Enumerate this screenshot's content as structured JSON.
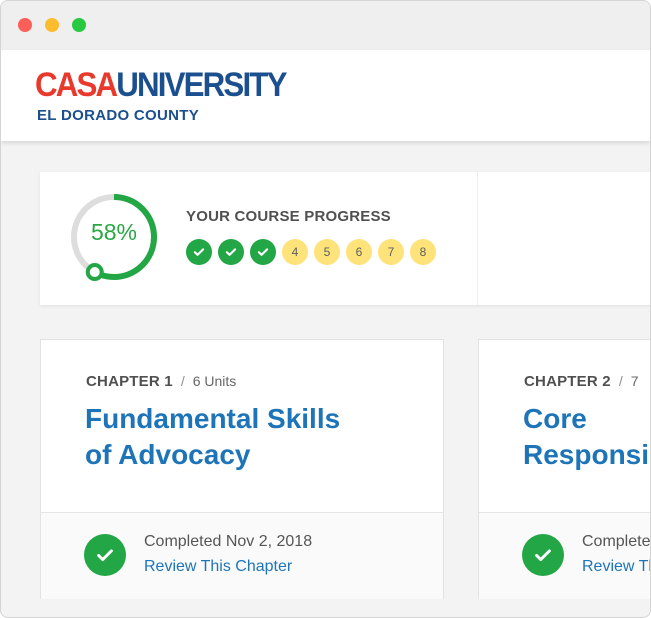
{
  "brand": {
    "logo_part1": "CASA",
    "logo_part2": "UNIVERSITY",
    "subtitle": "EL DORADO COUNTY",
    "colors": {
      "red": "#e8392c",
      "blue": "#1b4f8e"
    }
  },
  "progress": {
    "percent_label": "58%",
    "percent_value": 0.58,
    "title": "YOUR COURSE PROGRESS",
    "steps": [
      {
        "label": "",
        "state": "done",
        "icon": "check-icon"
      },
      {
        "label": "",
        "state": "done",
        "icon": "check-icon"
      },
      {
        "label": "",
        "state": "done",
        "icon": "check-icon"
      },
      {
        "label": "4",
        "state": "todo"
      },
      {
        "label": "5",
        "state": "todo"
      },
      {
        "label": "6",
        "state": "todo"
      },
      {
        "label": "7",
        "state": "todo"
      },
      {
        "label": "8",
        "state": "todo"
      }
    ],
    "colors": {
      "done": "#23a645",
      "todo": "#fde37a",
      "ring_track": "#dddddd"
    }
  },
  "chapters": [
    {
      "number_label": "CHAPTER 1",
      "separator": "/",
      "units": "6 Units",
      "title_line1": "Fundamental Skills",
      "title_line2": "of Advocacy",
      "completed": "Completed Nov 2, 2018",
      "review": "Review This Chapter"
    },
    {
      "number_label": "CHAPTER 2",
      "separator": "/",
      "units": "7",
      "title_line1": "Core",
      "title_line2": "Responsi",
      "completed": "Complete",
      "review": "Review Th"
    }
  ]
}
